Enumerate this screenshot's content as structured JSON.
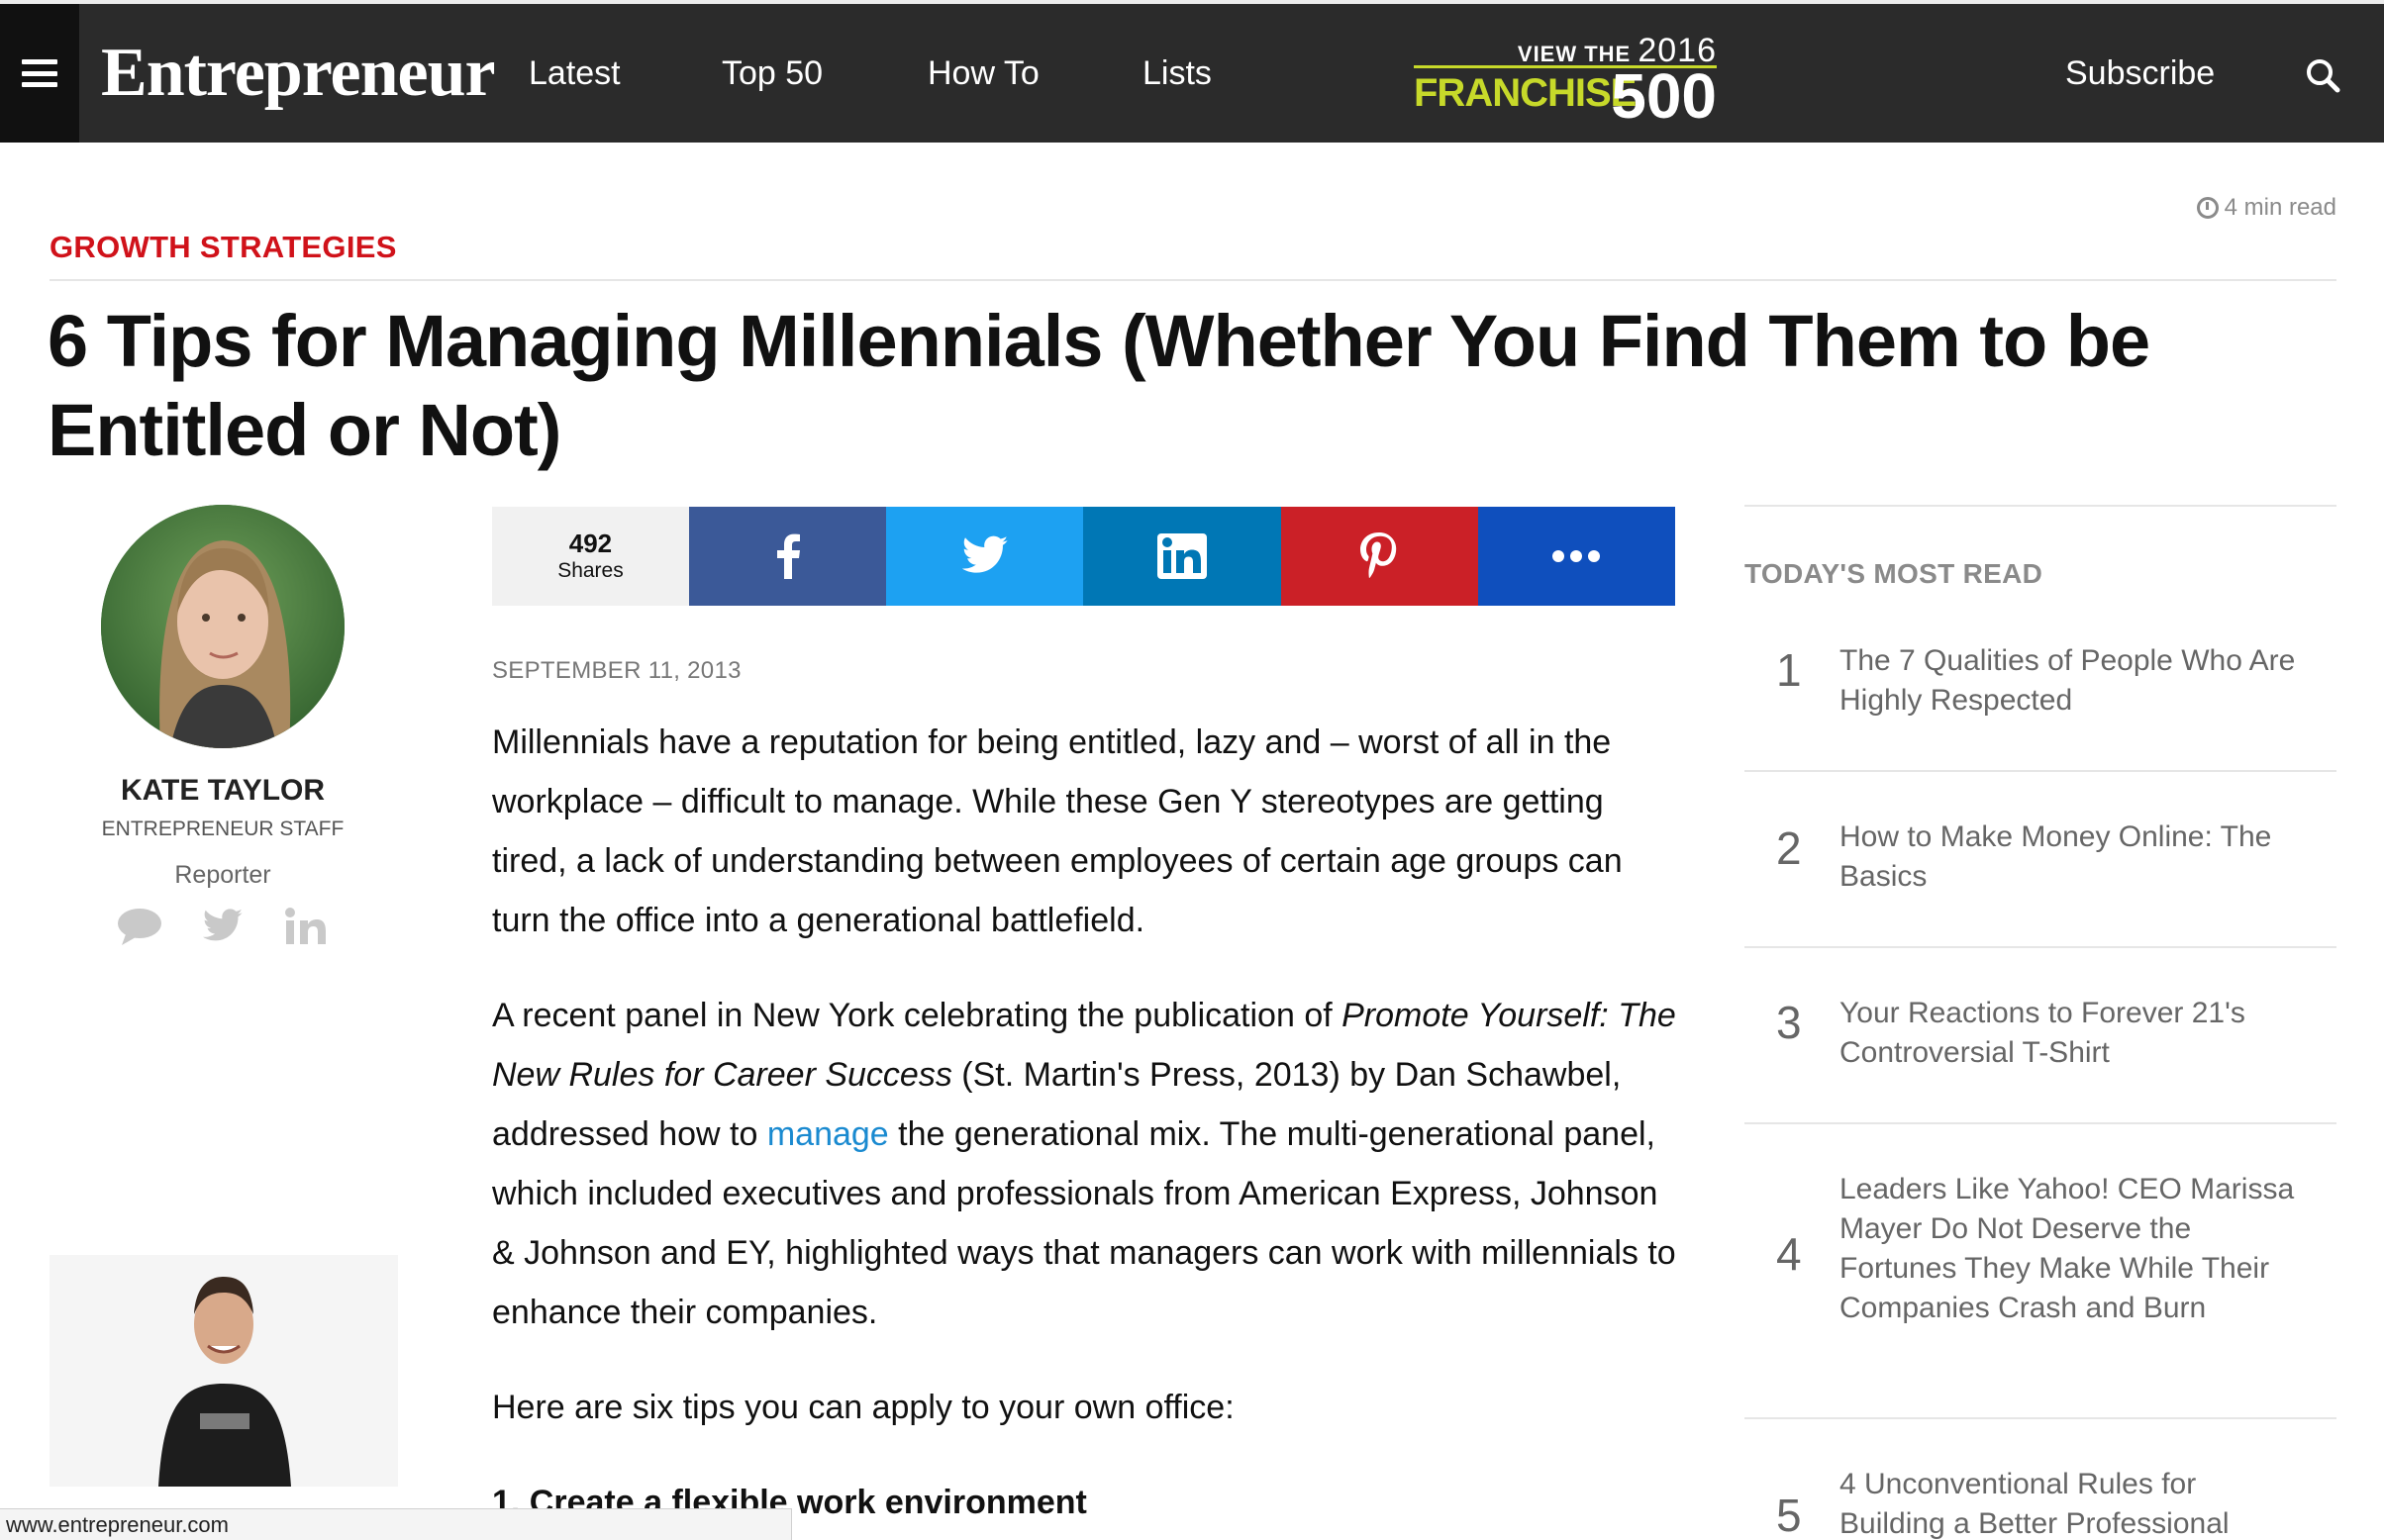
{
  "nav": {
    "logo": "Entrepreneur",
    "items": [
      {
        "label": "Latest"
      },
      {
        "label": "Top 50"
      },
      {
        "label": "How To"
      },
      {
        "label": "Lists"
      }
    ],
    "franchise": {
      "view": "VIEW THE",
      "year": "2016",
      "name": "FRANCHISE",
      "number": "500"
    },
    "subscribe": "Subscribe",
    "colors": {
      "bar": "#2b2b2b",
      "accent": "#c7d92a"
    }
  },
  "article": {
    "category": "GROWTH STRATEGIES",
    "read_time": "4 min read",
    "headline": "6 Tips for Managing Millennials (Whether You Find Them to be Entitled or Not)",
    "date": "SEPTEMBER 11, 2013",
    "p1": "Millennials have a reputation for being entitled, lazy and – worst of all in the workplace – difficult to manage. While these Gen Y stereotypes are getting tired, a lack of understanding between employees of certain age groups can turn the office into a generational battlefield.",
    "p2_a": "A recent panel in New York celebrating the publication of ",
    "p2_book": "Promote Yourself: The New Rules for Career Success",
    "p2_b": " (St. Martin's Press, 2013) by Dan Schawbel, addressed how to ",
    "p2_link": "manage",
    "p2_c": " the generational mix. The multi-generational panel, which included executives and professionals from American Express, Johnson & Johnson and EY, highlighted ways that managers can work with millennials to enhance their companies.",
    "p3": "Here are six tips you can apply to your own office:",
    "h1": "1. Create a flexible work environment",
    "category_color": "#d0121a",
    "link_color": "#1a8ad0"
  },
  "author": {
    "name": "KATE TAYLOR",
    "staff": "ENTREPRENEUR STAFF",
    "role": "Reporter",
    "social_icons": [
      "comment-icon",
      "twitter-icon",
      "linkedin-icon"
    ]
  },
  "share": {
    "count": "492",
    "label": "Shares",
    "buttons": [
      {
        "icon": "facebook-icon",
        "color": "#3b5998"
      },
      {
        "icon": "twitter-icon",
        "color": "#1da1f2"
      },
      {
        "icon": "linkedin-icon",
        "color": "#0077b5"
      },
      {
        "icon": "pinterest-icon",
        "color": "#cb2027"
      },
      {
        "icon": "more-icon",
        "color": "#0f4fbd"
      }
    ]
  },
  "sidebar": {
    "title": "TODAY'S MOST READ",
    "items": [
      {
        "n": "1",
        "title": "The 7 Qualities of People Who Are Highly Respected"
      },
      {
        "n": "2",
        "title": "How to Make Money Online: The Basics"
      },
      {
        "n": "3",
        "title": "Your Reactions to Forever 21's Controversial T-Shirt"
      },
      {
        "n": "4",
        "title": "Leaders Like Yahoo! CEO Marissa Mayer Do Not Deserve the Fortunes They Make While Their Companies Crash and Burn"
      },
      {
        "n": "5",
        "title": "4 Unconventional Rules for Building a Better Professional"
      }
    ]
  },
  "status_bar": {
    "url": "www.entrepreneur.com"
  }
}
